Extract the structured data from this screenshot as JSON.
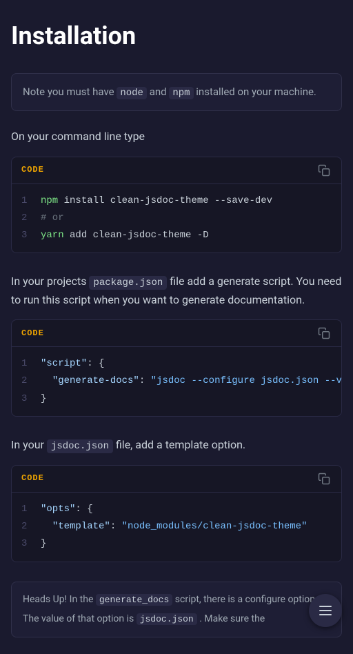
{
  "page": {
    "title": "Installation"
  },
  "note": {
    "text_before": "Note you must have",
    "code1": "node",
    "and": "and",
    "code2": "npm",
    "text_after": "installed on your machine."
  },
  "section1": {
    "text": "On your command line type"
  },
  "code1": {
    "label": "CODE",
    "lines": [
      {
        "num": "1",
        "content": "npm install clean-jsdoc-theme --save-dev"
      },
      {
        "num": "2",
        "content": "# or"
      },
      {
        "num": "3",
        "content": "yarn add clean-jsdoc-theme -D"
      }
    ]
  },
  "section2": {
    "text_before": "In your projects",
    "code": "package.json",
    "text_after": "file add a generate script. You need to run this script when you want to generate documentation."
  },
  "code2": {
    "label": "CODE",
    "lines": [
      {
        "num": "1",
        "key": "\"script\"",
        "colon": ": {"
      },
      {
        "num": "2",
        "key": "\"generate-docs\"",
        "colon": ": ",
        "value": "\"jsdoc --configure jsdoc.json --verbose\""
      },
      {
        "num": "3",
        "content": "}"
      }
    ]
  },
  "section3": {
    "text_before": "In your",
    "code": "jsdoc.json",
    "text_after": "file, add a template option."
  },
  "code3": {
    "label": "CODE",
    "lines": [
      {
        "num": "1",
        "key": "\"opts\"",
        "colon": ": {"
      },
      {
        "num": "2",
        "key": "\"template\"",
        "colon": ": ",
        "value": "\"node_modules/clean-jsdoc-theme\""
      },
      {
        "num": "3",
        "content": "}"
      }
    ]
  },
  "headsup": {
    "text_before": "Heads Up! In the",
    "code1": "generate_docs",
    "text_middle": "script, there is a configure option.",
    "text2": "The value of that option is",
    "code2": "jsdoc.json",
    "text3": ". Make sure the"
  },
  "fab": {
    "label": "menu"
  }
}
